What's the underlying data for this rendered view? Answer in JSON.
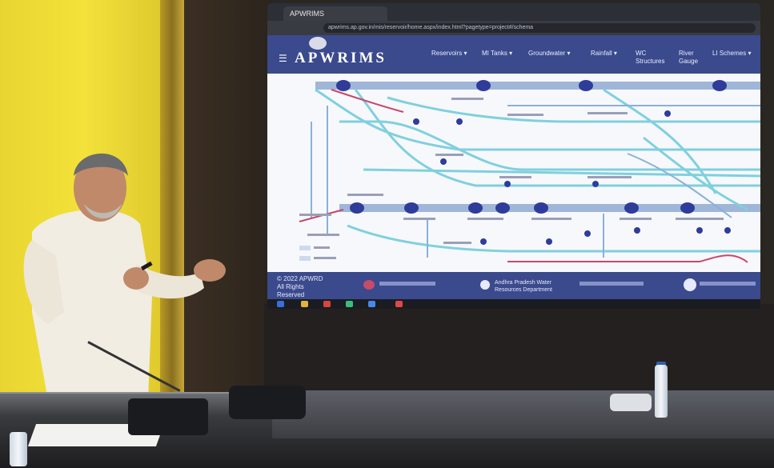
{
  "browser": {
    "tab_title": "APWRIMS",
    "url": "apwrims.ap.gov.in/mis/reservoir/home.aspx/index.html?pagetype=project#/schema"
  },
  "portal": {
    "logo": "APWRIMS",
    "nav_items": [
      "Reservoirs",
      "MI Tanks",
      "Groundwater",
      "Rainfall",
      "WC Structures",
      "River Gauge",
      "LI Schemes"
    ],
    "footer": {
      "copyright": "© 2022 APWRD All Rights Reserved",
      "partners": [
        "Andhra Pradesh Water Resources Department"
      ]
    }
  },
  "colors": {
    "nav": "#3a4a8c",
    "river": "#7fd0df",
    "canal": "#8ab0d8",
    "node": "#2f3c9a",
    "wall": "#f3e23a"
  }
}
